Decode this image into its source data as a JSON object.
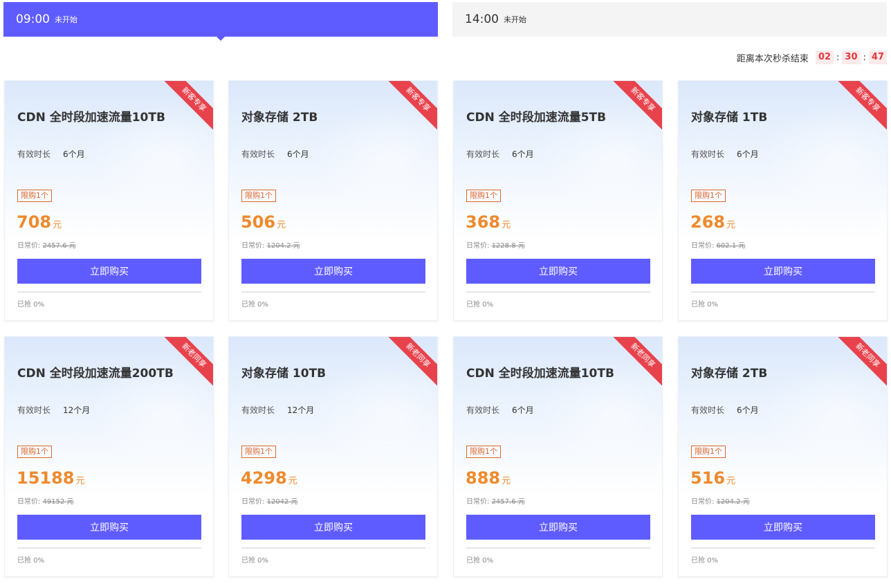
{
  "tabs": [
    {
      "time": "09:00",
      "status": "未开始",
      "active": true
    },
    {
      "time": "14:00",
      "status": "未开始",
      "active": false
    }
  ],
  "countdown": {
    "label": "距离本次秒杀结束",
    "hours": "02",
    "minutes": "30",
    "seconds": "47",
    "separator": ":"
  },
  "labels": {
    "duration_label": "有效时长",
    "original_price_label": "日常价:",
    "buy_button": "立即购买",
    "price_unit": "元",
    "limit": "限购1个"
  },
  "colors": {
    "accent": "#5f5cff",
    "price": "#ee8a2d",
    "ribbon": "#e8434d",
    "countdown": "#e0393e"
  },
  "products": [
    {
      "ribbon": "新客专享",
      "title": "CDN 全时段加速流量10TB",
      "duration": "6个月",
      "price": "708",
      "original": "2457.6 元",
      "sold": "已抢 0%",
      "sold_fraction": 0
    },
    {
      "ribbon": "新客专享",
      "title": "对象存储 2TB",
      "duration": "6个月",
      "price": "506",
      "original": "1204.2 元",
      "sold": "已抢 0%",
      "sold_fraction": 0
    },
    {
      "ribbon": "新客专享",
      "title": "CDN 全时段加速流量5TB",
      "duration": "6个月",
      "price": "368",
      "original": "1228.8 元",
      "sold": "已抢 0%",
      "sold_fraction": 0
    },
    {
      "ribbon": "新客专享",
      "title": "对象存储 1TB",
      "duration": "6个月",
      "price": "268",
      "original": "602.1 元",
      "sold": "已抢 0%",
      "sold_fraction": 0
    },
    {
      "ribbon": "新老同享",
      "title": "CDN 全时段加速流量200TB",
      "duration": "12个月",
      "price": "15188",
      "original": "49152 元",
      "sold": "已抢 0%",
      "sold_fraction": 0
    },
    {
      "ribbon": "新老同享",
      "title": "对象存储 10TB",
      "duration": "12个月",
      "price": "4298",
      "original": "12042 元",
      "sold": "已抢 0%",
      "sold_fraction": 0
    },
    {
      "ribbon": "新老同享",
      "title": "CDN 全时段加速流量10TB",
      "duration": "6个月",
      "price": "888",
      "original": "2457.6 元",
      "sold": "已抢 0%",
      "sold_fraction": 0
    },
    {
      "ribbon": "新老同享",
      "title": "对象存储 2TB",
      "duration": "6个月",
      "price": "516",
      "original": "1204.2 元",
      "sold": "已抢 0%",
      "sold_fraction": 0
    }
  ]
}
